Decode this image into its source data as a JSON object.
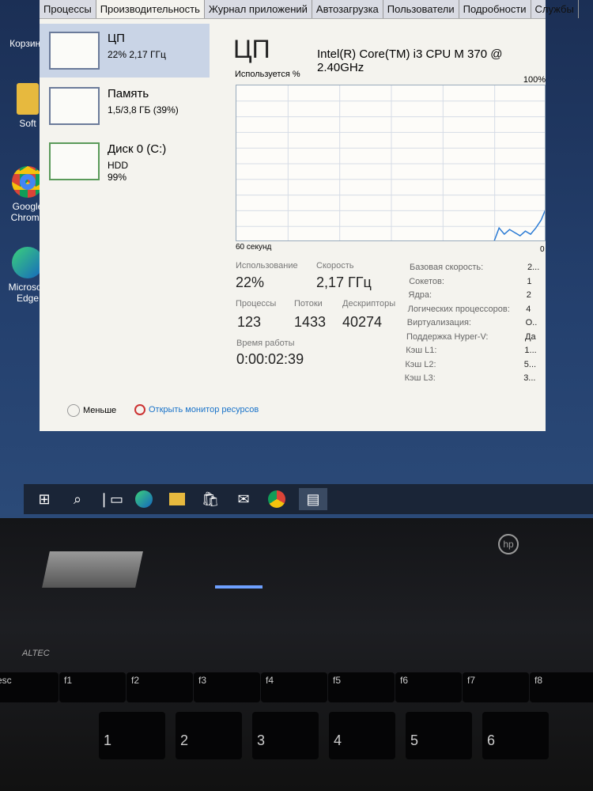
{
  "desktop": {
    "icons": [
      {
        "label": "Корзина"
      },
      {
        "label": "Soft"
      },
      {
        "label": "Google Chrome"
      },
      {
        "label": "Microsoft Edge"
      }
    ]
  },
  "tabs": [
    {
      "label": "Процессы"
    },
    {
      "label": "Производительность",
      "active": true
    },
    {
      "label": "Журнал приложений"
    },
    {
      "label": "Автозагрузка"
    },
    {
      "label": "Пользователи"
    },
    {
      "label": "Подробности"
    },
    {
      "label": "Службы"
    }
  ],
  "sidebar": [
    {
      "title": "ЦП",
      "line1": "22% 2,17 ГГц",
      "line2": ""
    },
    {
      "title": "Память",
      "line1": "1,5/3,8 ГБ (39%)",
      "line2": ""
    },
    {
      "title": "Диск 0 (C:)",
      "line1": "HDD",
      "line2": "99%"
    }
  ],
  "main": {
    "title": "ЦП",
    "cpu_name": "Intel(R) Core(TM) i3 CPU M 370 @ 2.40GHz",
    "graph_label": "Используется %",
    "graph_max": "100%",
    "graph_left": "60 секунд",
    "graph_right": "0",
    "usage_label": "Использование",
    "usage": "22%",
    "speed_label": "Скорость",
    "speed": "2,17 ГГц",
    "proc_label": "Процессы",
    "proc": "123",
    "threads_label": "Потоки",
    "threads": "1433",
    "handles_label": "Дескрипторы",
    "handles": "40274",
    "uptime_label": "Время работы",
    "uptime": "0:00:02:39",
    "specs": [
      {
        "k": "Базовая скорость:",
        "v": "2..."
      },
      {
        "k": "Сокетов:",
        "v": "1"
      },
      {
        "k": "Ядра:",
        "v": "2"
      },
      {
        "k": "Логических процессоров:",
        "v": "4"
      },
      {
        "k": "Виртуализация:",
        "v": "О.."
      },
      {
        "k": "Поддержка Hyper-V:",
        "v": "Да"
      },
      {
        "k": "Кэш L1:",
        "v": "1..."
      },
      {
        "k": "Кэш L2:",
        "v": "5..."
      },
      {
        "k": "Кэш L3:",
        "v": "3..."
      }
    ]
  },
  "footer": {
    "less": "Меньше",
    "monitor": "Открыть монитор ресурсов"
  },
  "cpu_history_percent": [
    0,
    0,
    0,
    0,
    0,
    0,
    0,
    0,
    0,
    0,
    0,
    0,
    0,
    0,
    0,
    0,
    0,
    0,
    0,
    0,
    0,
    0,
    0,
    0,
    0,
    0,
    0,
    0,
    0,
    0,
    0,
    0,
    0,
    0,
    0,
    0,
    0,
    0,
    0,
    0,
    0,
    0,
    0,
    0,
    0,
    0,
    0,
    0,
    0,
    0,
    9,
    5,
    8,
    6,
    4,
    7,
    5,
    9,
    14,
    22
  ],
  "keyboard": {
    "brand": "ALTEC",
    "fkeys": [
      "esc",
      "f1",
      "f2",
      "f3",
      "f4",
      "f5",
      "f6",
      "f7",
      "f8"
    ],
    "numkeys": [
      "1",
      "2",
      "3",
      "4",
      "5",
      "6"
    ]
  },
  "accent": "#1a73c9"
}
